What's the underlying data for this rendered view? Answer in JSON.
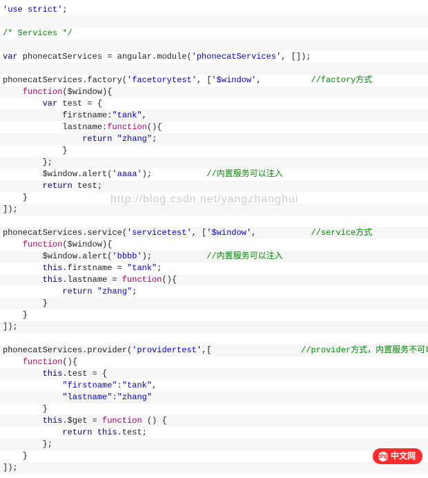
{
  "code": {
    "l1": "'use strict'",
    "l2": "/* Services */",
    "l3a": "var",
    "l3b": " phonecatServices = angular.module(",
    "l3c": "'phonecatServices'",
    "l3d": ", []);",
    "l4a": "phonecatServices.factory(",
    "l4b": "'facetorytest'",
    "l4c": ", [",
    "l4d": "'$window'",
    "l4e": ",          ",
    "l4f": "//factory方式",
    "l5a": "    ",
    "l5b": "function",
    "l5c": "($window){",
    "l6a": "        ",
    "l6b": "var",
    "l6c": " test = {",
    "l7a": "            firstname:",
    "l7b": "\"tank\"",
    "l7c": ",",
    "l8a": "            lastname:",
    "l8b": "function",
    "l8c": "(){",
    "l9a": "                ",
    "l9b": "return",
    "l9c": " ",
    "l9d": "\"zhang\"",
    "l9e": ";",
    "l10": "            }",
    "l11": "        };",
    "l12a": "        $window.alert(",
    "l12b": "'aaaa'",
    "l12c": ");           ",
    "l12d": "//内置服务可以注入",
    "l13a": "        ",
    "l13b": "return",
    "l13c": " test;",
    "l14": "    }",
    "l15": "]);",
    "l16a": "phonecatServices.service(",
    "l16b": "'servicetest'",
    "l16c": ", [",
    "l16d": "'$window'",
    "l16e": ",           ",
    "l16f": "//service方式",
    "l17a": "    ",
    "l17b": "function",
    "l17c": "($window){",
    "l18a": "        $window.alert(",
    "l18b": "'bbbb'",
    "l18c": ");           ",
    "l18d": "//内置服务可以注入",
    "l19a": "        ",
    "l19b": "this",
    "l19c": ".firstname = ",
    "l19d": "\"tank\"",
    "l19e": ";",
    "l20a": "        ",
    "l20b": "this",
    "l20c": ".lastname = ",
    "l20d": "function",
    "l20e": "(){",
    "l21a": "            ",
    "l21b": "return",
    "l21c": " ",
    "l21d": "\"zhang\"",
    "l21e": ";",
    "l22": "        }",
    "l23": "    }",
    "l24": "]);",
    "l25a": "phonecatServices.provider(",
    "l25b": "'providertest'",
    "l25c": ",[                  ",
    "l25d": "//provider方式，内置服务不可以注入",
    "l26a": "    ",
    "l26b": "function",
    "l26c": "(){",
    "l27a": "        ",
    "l27b": "this",
    "l27c": ".test = {",
    "l28a": "            ",
    "l28b": "\"firstname\"",
    "l28c": ":",
    "l28d": "\"tank\"",
    "l28e": ",",
    "l29a": "            ",
    "l29b": "\"lastname\"",
    "l29c": ":",
    "l29d": "\"zhang\"",
    "l30": "        }",
    "l31a": "        ",
    "l31b": "this",
    "l31c": ".$get = ",
    "l31d": "function",
    "l31e": " () {",
    "l32a": "            ",
    "l32b": "return",
    "l32c": " ",
    "l32d": "this",
    "l32e": ".test;",
    "l33": "        };",
    "l34": "    }",
    "l35": "]);"
  },
  "watermark": "http://blog.csdn.net/yangzhanghui",
  "badge": {
    "icon": "php",
    "text": "中文网"
  }
}
